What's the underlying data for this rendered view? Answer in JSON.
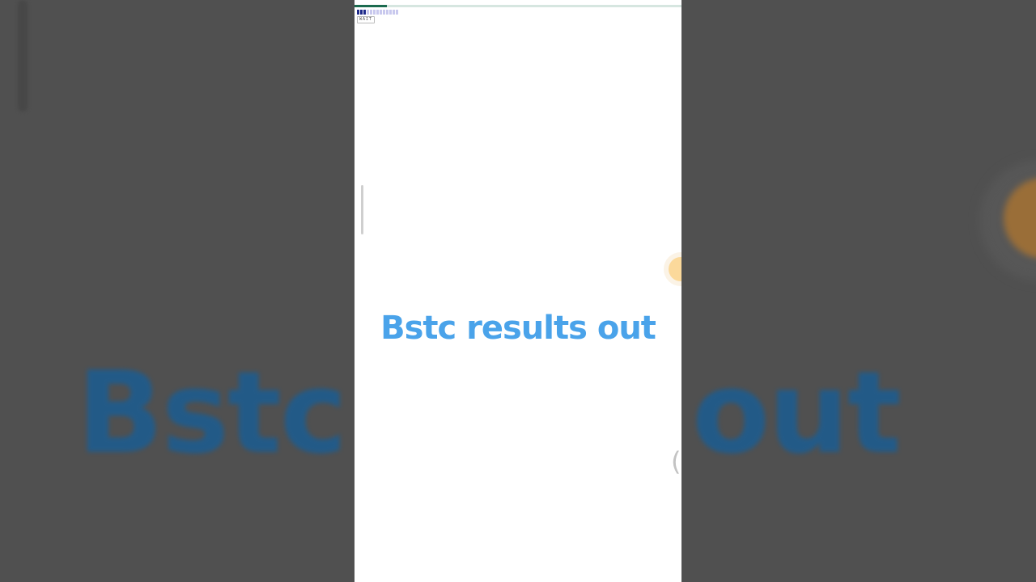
{
  "headline": {
    "text": "Bstc results out",
    "color": "#4aa3ea"
  },
  "backdrop": {
    "text_left": "Bstc",
    "text_right": "s out",
    "color": "#1e5c8e"
  },
  "status": {
    "wait_label": "WAIT",
    "load_progress": 0.1,
    "signal_bars_on": 3,
    "signal_bars_total": 13
  },
  "fab": {
    "icon": "badge-icon",
    "color": "#fbd99b"
  },
  "side_glyph": "("
}
